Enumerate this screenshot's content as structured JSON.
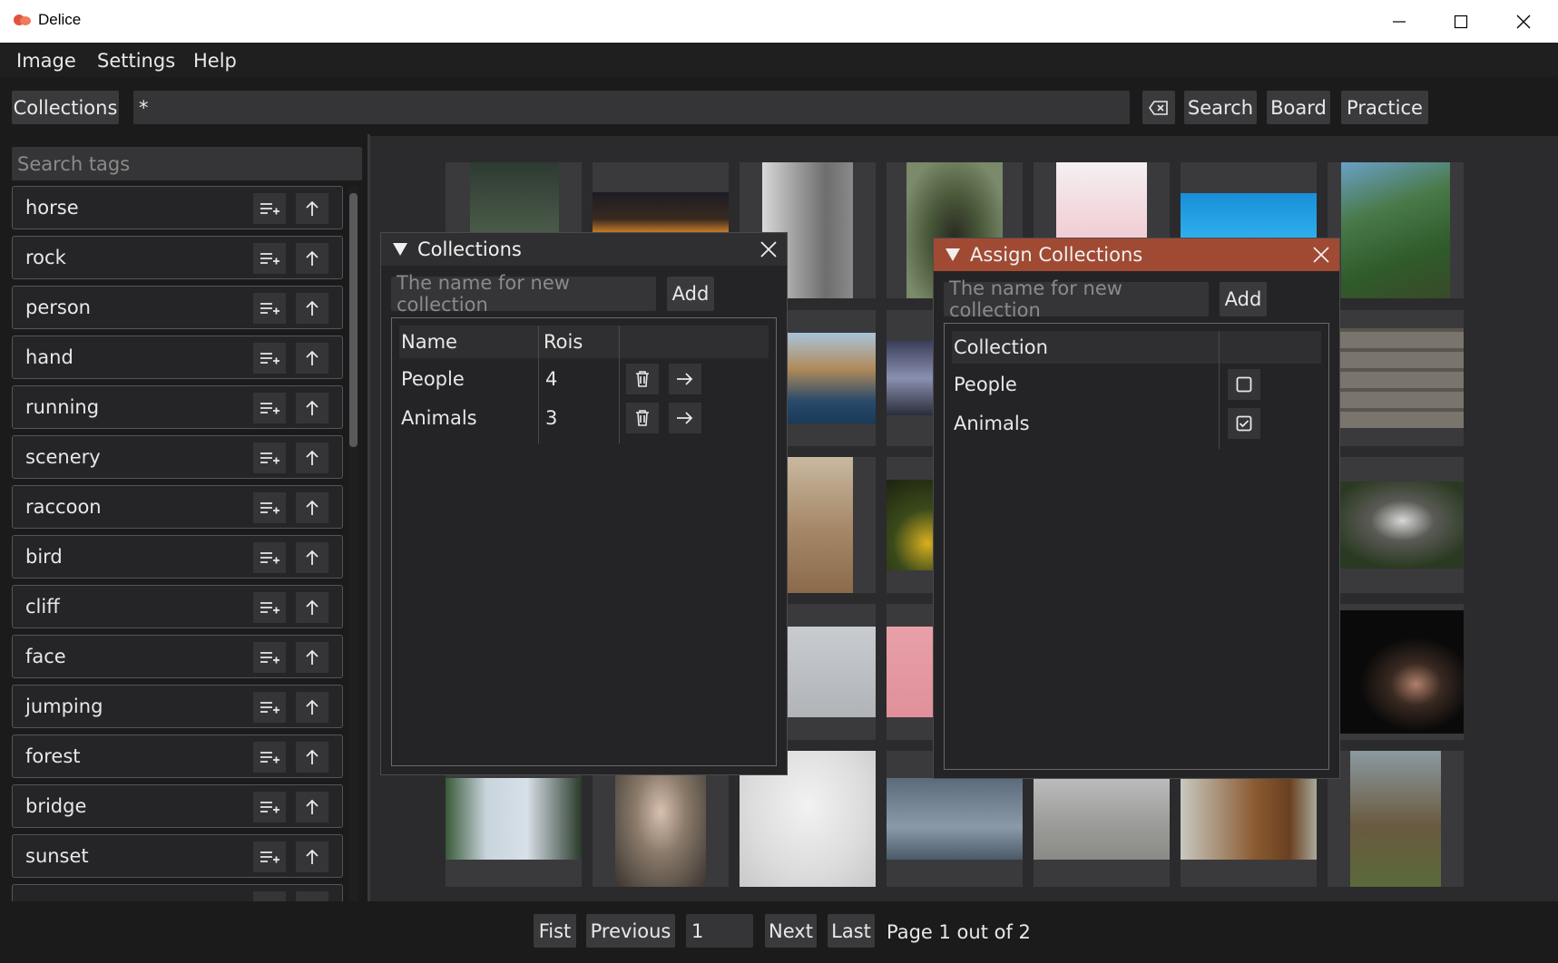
{
  "app": {
    "title": "Delice"
  },
  "menu": [
    "Image",
    "Settings",
    "Help"
  ],
  "toolbar": {
    "collections_label": "Collections",
    "query_value": "*",
    "search_label": "Search",
    "board_label": "Board",
    "practice_label": "Practice"
  },
  "tag_search": {
    "placeholder": "Search tags"
  },
  "tags": [
    "horse",
    "rock",
    "person",
    "hand",
    "running",
    "scenery",
    "raccoon",
    "bird",
    "cliff",
    "face",
    "jumping",
    "forest",
    "bridge",
    "sunset"
  ],
  "collections_window": {
    "title": "Collections",
    "name_placeholder": "The name for new collection",
    "add_label": "Add",
    "headers": [
      "Name",
      "Rois"
    ],
    "rows": [
      {
        "name": "People",
        "rois": "4"
      },
      {
        "name": "Animals",
        "rois": "3"
      }
    ]
  },
  "assign_window": {
    "title": "Assign Collections",
    "name_placeholder": "The name for new collection",
    "add_label": "Add",
    "header": "Collection",
    "rows": [
      {
        "name": "People",
        "checked": false
      },
      {
        "name": "Animals",
        "checked": true
      }
    ]
  },
  "pagination": {
    "first_label": "Fist",
    "previous_label": "Previous",
    "page_value": "1",
    "next_label": "Next",
    "last_label": "Last",
    "status": "Page 1 out of 2"
  },
  "colors": {
    "accent_title": "#a14a33",
    "background": "#2b2b2d",
    "panel": "#1b1b1c"
  }
}
